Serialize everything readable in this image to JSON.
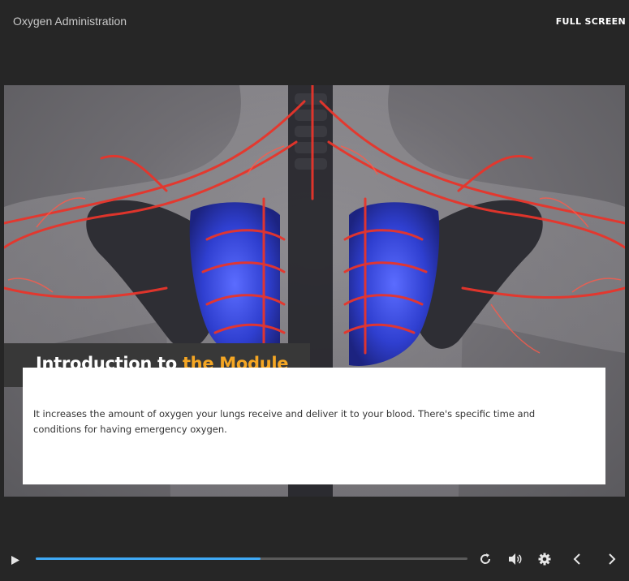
{
  "header": {
    "title": "Oxygen Administration",
    "fullscreen_label": "FULL SCREEN"
  },
  "slide": {
    "title_primary": "Introduction to",
    "title_accent": "the Module",
    "body": "It increases the amount of oxygen your lungs receive and deliver it to your blood. There's specific time and conditions for having emergency oxygen."
  },
  "player": {
    "progress_fraction": 0.52,
    "icons": [
      "play-icon",
      "replay-icon",
      "volume-icon",
      "settings-icon",
      "previous-icon",
      "next-icon"
    ]
  },
  "colors": {
    "background": "#262626",
    "accent": "#f5a623",
    "progress": "#3fa9f5",
    "title_box": "#383838"
  }
}
